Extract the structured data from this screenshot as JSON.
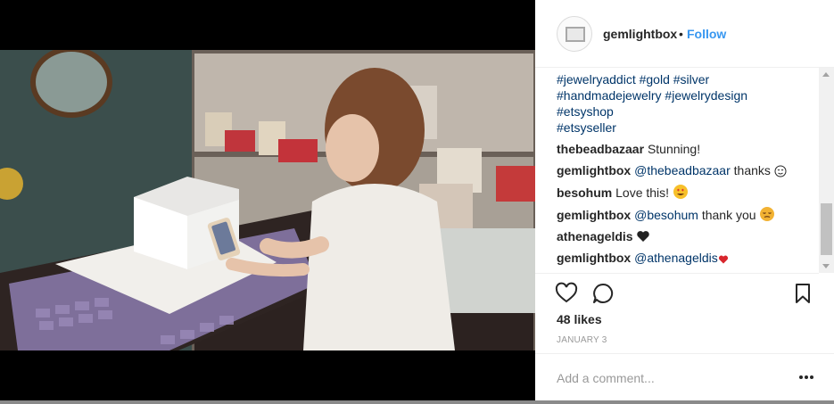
{
  "post": {
    "username": "gemlightbox",
    "separator": "•",
    "follow_label": "Follow",
    "likes": "48 likes",
    "date": "JANUARY 3",
    "comment_placeholder": "Add a comment..."
  },
  "caption_tags": [
    [
      "#jewelryaddict",
      "#gold",
      "#silver"
    ],
    [
      "#handmadejewelry",
      "#jewelrydesign"
    ],
    [
      "#etsyshop"
    ],
    [
      "#etsyseller"
    ]
  ],
  "comments": [
    {
      "user": "thebeadbazaar",
      "text": "Stunning!"
    },
    {
      "user": "gemlightbox",
      "mention": "@thebeadbazaar",
      "text": "thanks",
      "emoji": "relieved-face"
    },
    {
      "user": "besohum",
      "text": "Love this!",
      "emoji": "heart-eyes-face"
    },
    {
      "user": "gemlightbox",
      "mention": "@besohum",
      "text": "thank you",
      "emoji": "pensive-face"
    },
    {
      "user": "athenageldis",
      "text": "",
      "emoji": "black-heart"
    },
    {
      "user": "gemlightbox",
      "mention": "@athenageldis",
      "text": "",
      "emoji": "red-heart"
    }
  ],
  "icons": {
    "like": "heart-outline-icon",
    "comment": "speech-bubble-icon",
    "save": "bookmark-icon",
    "more": "more-options-icon"
  },
  "colors": {
    "link": "#003569",
    "follow": "#3897f0",
    "text": "#262626",
    "muted": "#999999"
  }
}
